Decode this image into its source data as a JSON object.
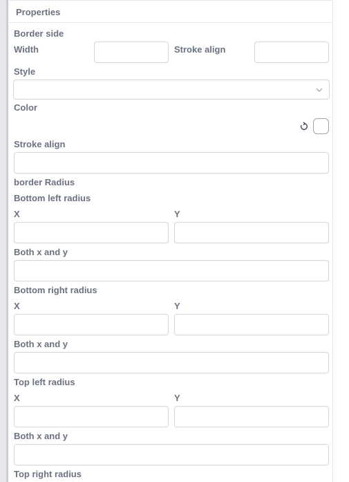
{
  "panel": {
    "title": "Properties"
  },
  "border_side": {
    "heading": "Border side",
    "width_label": "Width",
    "width_value": "",
    "stroke_align_label": "Stroke align",
    "stroke_align_value": "",
    "style_label": "Style",
    "style_value": "",
    "color_label": "Color",
    "stroke_align_full_label": "Stroke align",
    "stroke_align_full_value": ""
  },
  "border_radius": {
    "heading": "border Radius",
    "bottom_left": {
      "title": "Bottom left radius",
      "x_label": "X",
      "y_label": "Y",
      "both_label": "Both x and y"
    },
    "bottom_right": {
      "title": "Bottom right radius",
      "x_label": "X",
      "y_label": "Y",
      "both_label": "Both x and y"
    },
    "top_left": {
      "title": "Top left radius",
      "x_label": "X",
      "y_label": "Y",
      "both_label": "Both x and y"
    },
    "top_right": {
      "title": "Top right radius"
    }
  },
  "colors": {
    "border": "#d1d5db",
    "label": "#6b7280",
    "rail": "#c9ced6"
  },
  "icons": {
    "reset": "reset-icon",
    "dropdown": "chevron-down-icon",
    "swatch": "color-swatch"
  }
}
